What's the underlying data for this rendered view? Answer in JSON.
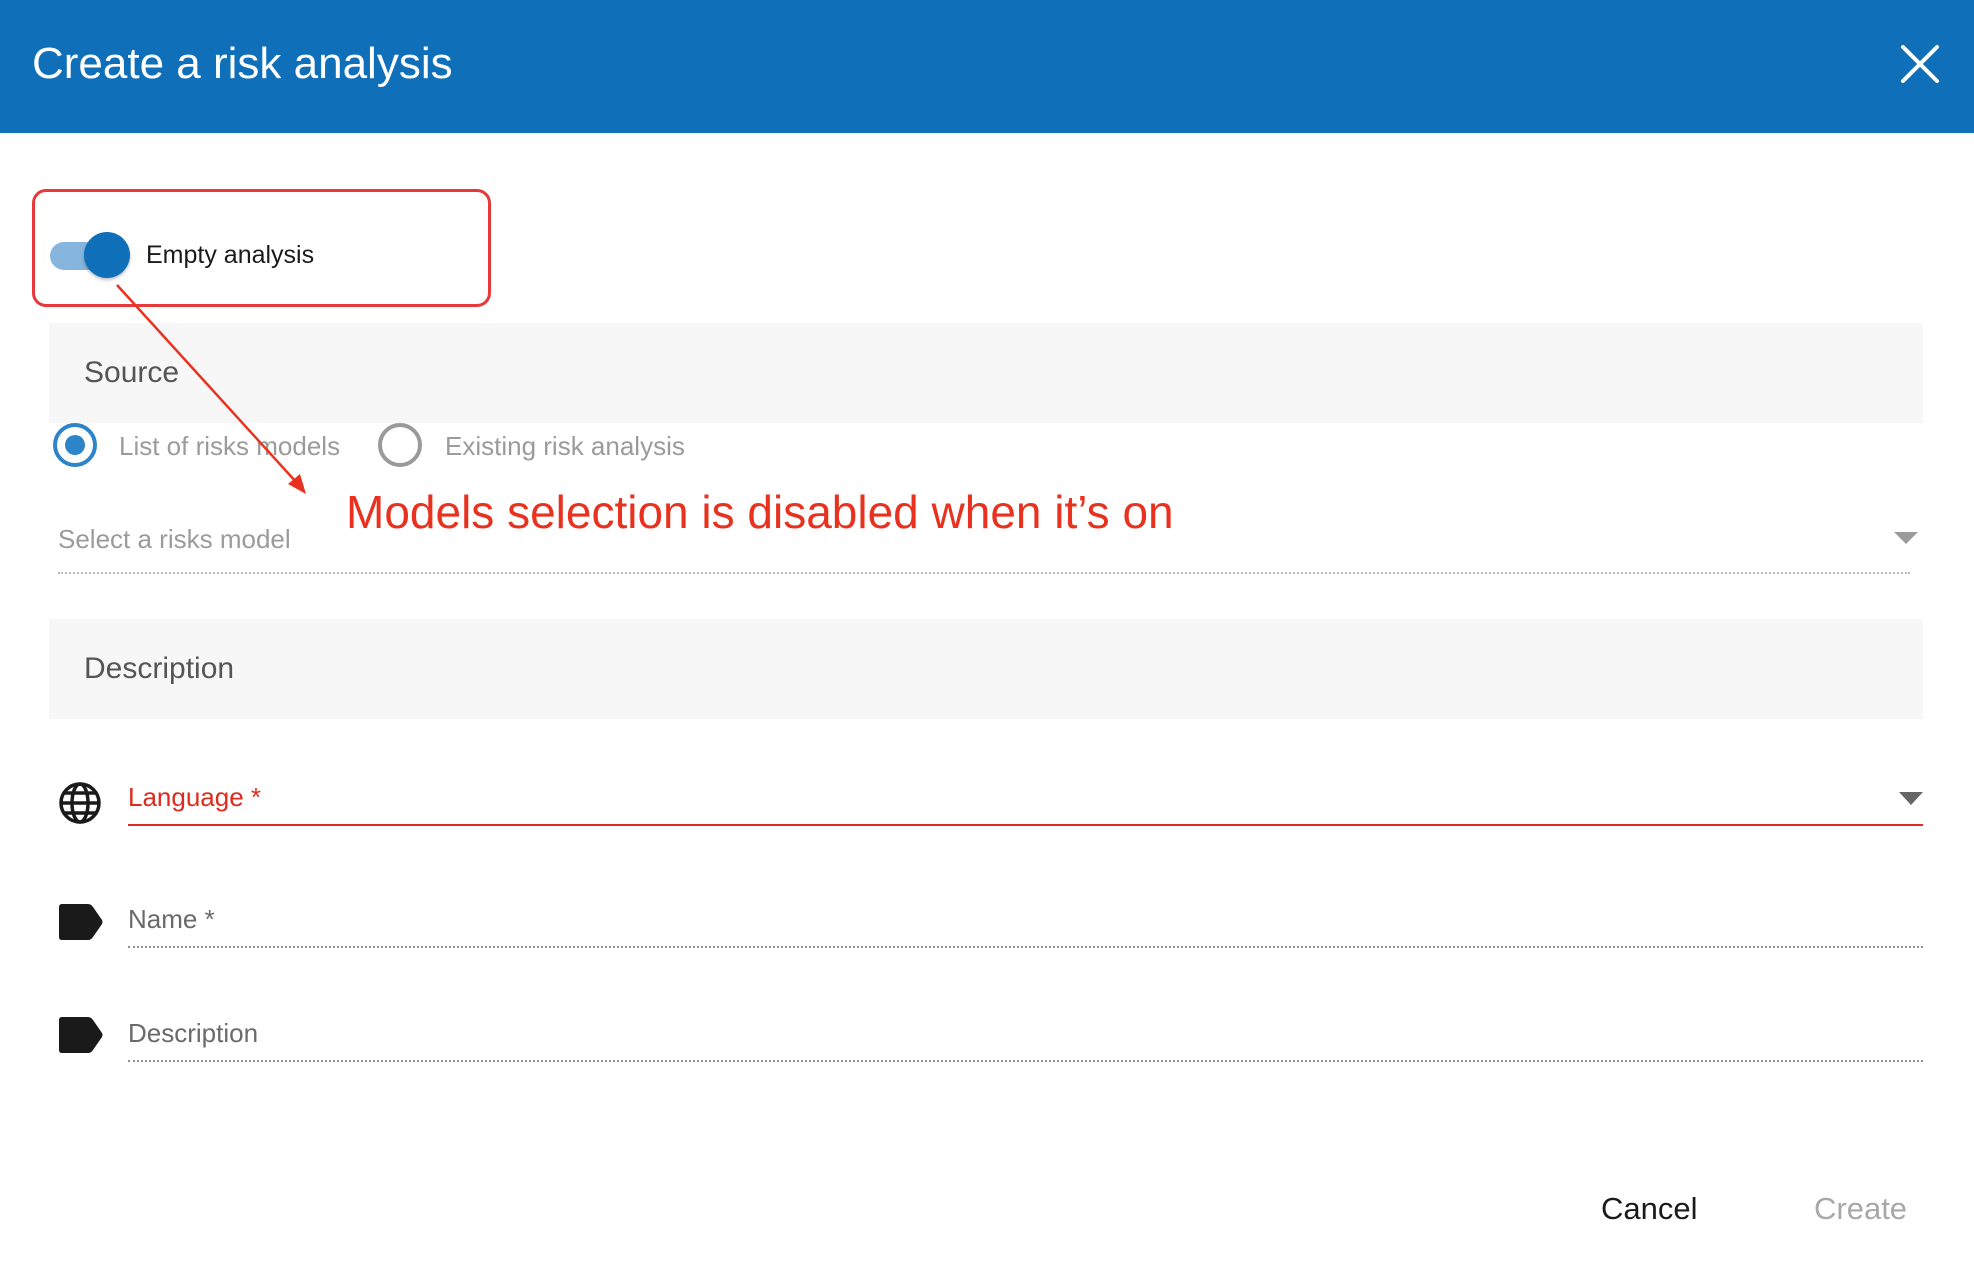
{
  "dialog": {
    "title": "Create a risk analysis"
  },
  "toggle": {
    "label": "Empty analysis",
    "on": true
  },
  "source": {
    "title": "Source",
    "options": [
      {
        "label": "List of risks models",
        "selected": true
      },
      {
        "label": "Existing risk analysis",
        "selected": false
      }
    ],
    "select_placeholder": "Select a risks model"
  },
  "annotation": {
    "text": "Models selection is disabled when it’s on"
  },
  "description_section": {
    "title": "Description"
  },
  "fields": {
    "language_label": "Language *",
    "name_label": "Name *",
    "description_label": "Description"
  },
  "footer": {
    "cancel_label": "Cancel",
    "create_label": "Create"
  },
  "colors": {
    "header": "#0f6fb8",
    "annotation": "#e8321f",
    "error": "#dd2c1f",
    "radio_selected": "#2d84c9"
  },
  "icons": {
    "close": "close-icon",
    "language": "globe-icon",
    "name": "label-tag-icon",
    "description": "label-tag-icon"
  }
}
